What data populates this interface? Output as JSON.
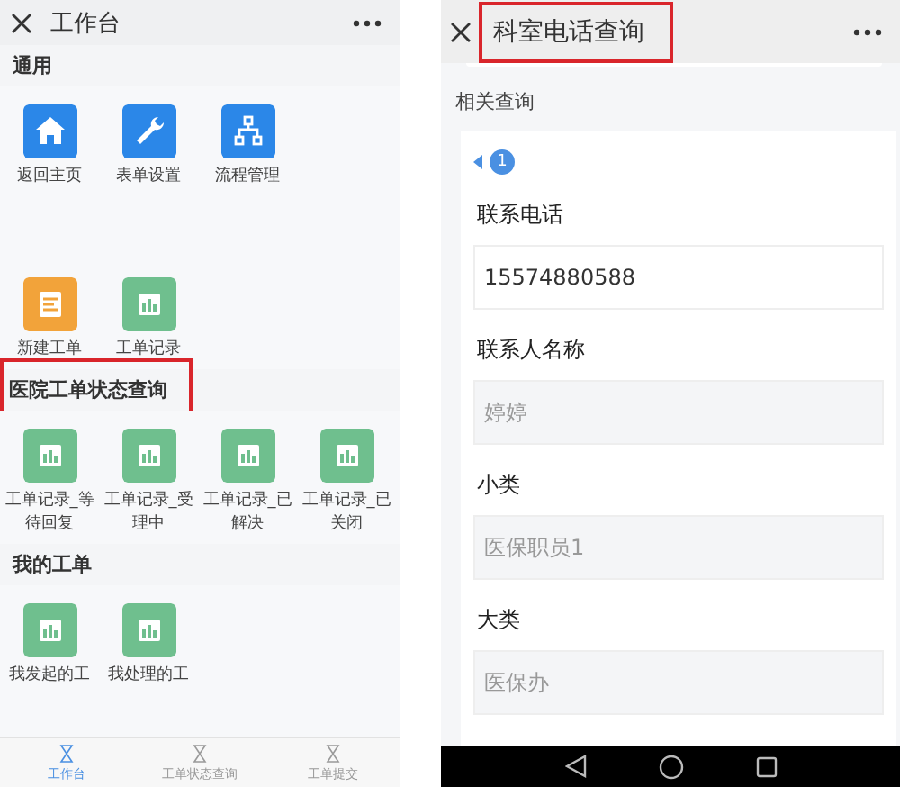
{
  "workbench": {
    "title": "工作台",
    "sections": [
      {
        "title": "通用",
        "highlighted": false,
        "items": [
          {
            "label": "返回主页",
            "kind": "home",
            "color": "#2b87e8"
          },
          {
            "label": "表单设置",
            "kind": "wrench",
            "color": "#2b87e8"
          },
          {
            "label": "流程管理",
            "kind": "flow",
            "color": "#2b87e8"
          }
        ]
      },
      {
        "items": [
          {
            "label": "新建工单",
            "kind": "form",
            "color": "#f2a33a"
          },
          {
            "label": "工单记录",
            "kind": "chart",
            "color": "#6fbf8e"
          }
        ]
      },
      {
        "title": "医院工单状态查询",
        "highlighted": true,
        "items": [
          {
            "label": "工单记录_等待回复",
            "kind": "chart",
            "color": "#6fbf8e"
          },
          {
            "label": "工单记录_受理中",
            "kind": "chart",
            "color": "#6fbf8e"
          },
          {
            "label": "工单记录_已解决",
            "kind": "chart",
            "color": "#6fbf8e"
          },
          {
            "label": "工单记录_已关闭",
            "kind": "chart",
            "color": "#6fbf8e"
          }
        ]
      },
      {
        "title": "我的工单",
        "highlighted": false,
        "items": [
          {
            "label": "我发起的工",
            "kind": "chart",
            "color": "#6fbf8e"
          },
          {
            "label": "我处理的工",
            "kind": "chart",
            "color": "#6fbf8e"
          }
        ]
      }
    ],
    "tabs": [
      {
        "label": "工作台",
        "selected": true
      },
      {
        "label": "工单状态查询",
        "selected": false
      },
      {
        "label": "工单提交",
        "selected": false
      }
    ]
  },
  "query": {
    "title": "科室电话查询",
    "highlighted": true,
    "section_label": "相关查询",
    "page": "1",
    "fields": [
      {
        "label": "联系电话",
        "value": "15574880588",
        "disabled": false
      },
      {
        "label": "联系人名称",
        "value": "婷婷",
        "disabled": true
      },
      {
        "label": "小类",
        "value": "医保职员1",
        "disabled": true
      },
      {
        "label": "大类",
        "value": "医保办",
        "disabled": true
      }
    ]
  }
}
